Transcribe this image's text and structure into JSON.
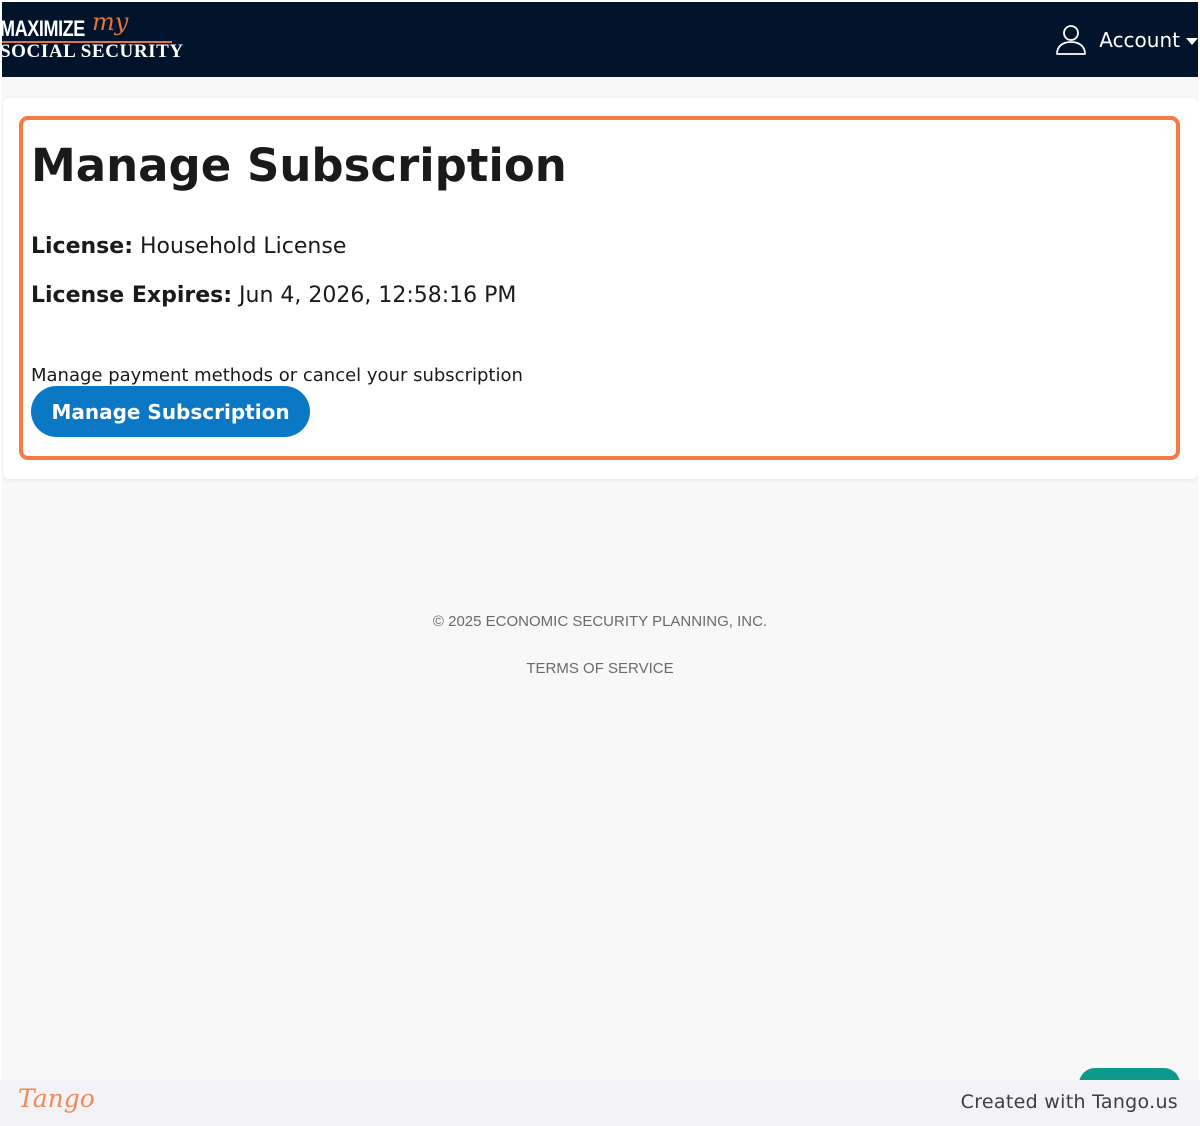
{
  "header": {
    "logo": {
      "word1": "MAXIMIZE",
      "word2": "my",
      "word3": "SOCIAL SECURITY"
    },
    "account_label": "Account"
  },
  "card": {
    "title": "Manage Subscription",
    "license_label": "License:",
    "license_value": "Household License",
    "expires_label": "License Expires:",
    "expires_value": "Jun 4, 2026, 12:58:16 PM",
    "description": "Manage payment methods or cancel your subscription",
    "button_label": "Manage Subscription"
  },
  "footer": {
    "copyright": "© 2025 ECONOMIC SECURITY PLANNING, INC.",
    "terms": "TERMS OF SERVICE"
  },
  "tango": {
    "logo_text": "Tango",
    "credit": "Created with Tango.us"
  },
  "colors": {
    "header_bg": "#02142b",
    "accent_orange": "#f57a45",
    "button_blue": "#0a78c4",
    "chat_teal": "#0e9a8a"
  },
  "icons": {
    "account": "user-icon",
    "account_dropdown": "caret-down-icon"
  }
}
